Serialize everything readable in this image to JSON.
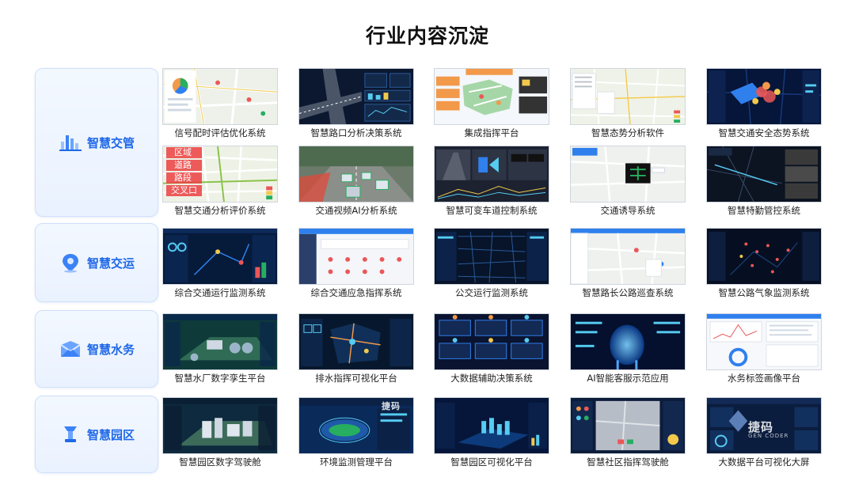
{
  "title": "行业内容沉淀",
  "categories": [
    {
      "label": "智慧交管",
      "icon": "bar-chart-icon"
    },
    {
      "label": "智慧交运",
      "icon": "location-pin-icon"
    },
    {
      "label": "智慧水务",
      "icon": "water-envelope-icon"
    },
    {
      "label": "智慧园区",
      "icon": "tower-icon"
    }
  ],
  "tiles": [
    [
      "信号配时评估优化系统",
      "智慧路口分析决策系统",
      "集成指挥平台",
      "智慧态势分析软件",
      "智慧交通安全态势系统"
    ],
    [
      "智慧交通分析评价系统",
      "交通视频AI分析系统",
      "智慧可变车道控制系统",
      "交通诱导系统",
      "智慧特勤管控系统"
    ],
    [
      "综合交通运行监测系统",
      "综合交通应急指挥系统",
      "公交运行监测系统",
      "智慧路长公路巡查系统",
      "智慧公路气象监测系统"
    ],
    [
      "智慧水厂数字孪生平台",
      "排水指挥可视化平台",
      "大数据辅助决策系统",
      "AI智能客服示范应用",
      "水务标签画像平台"
    ],
    [
      "智慧园区数字驾驶舱",
      "环境监测管理平台",
      "智慧园区可视化平台",
      "智慧社区指挥驾驶舱",
      "大数据平台可视化大屏"
    ]
  ],
  "map_overlay_labels": [
    "区域",
    "道路",
    "路段",
    "交叉口"
  ],
  "watermark": {
    "brand": "捷码",
    "sub": "GEN CODER"
  }
}
